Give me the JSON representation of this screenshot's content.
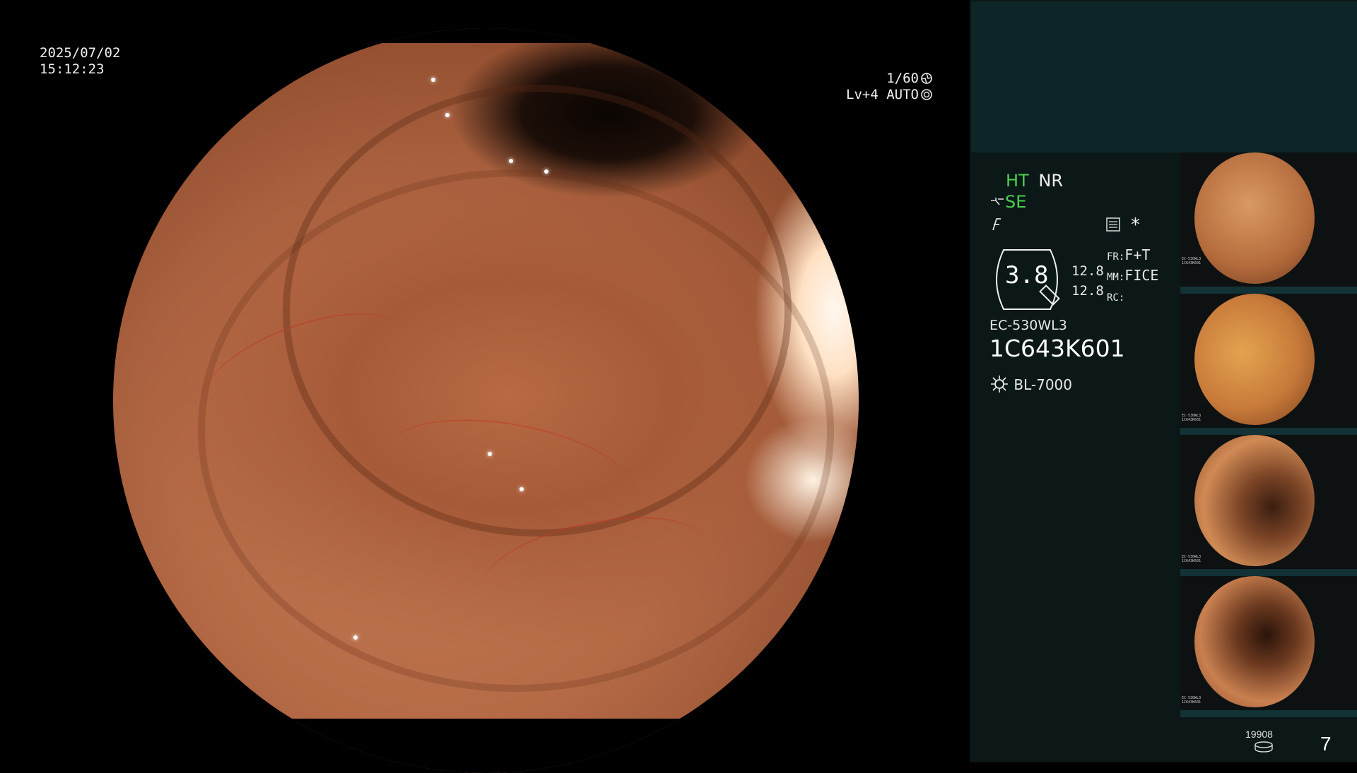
{
  "datetime": {
    "date": "2025/07/02",
    "time": "15:12:23"
  },
  "shutter": {
    "value": "1/60",
    "icon": "shutter-icon"
  },
  "exposure": {
    "level": "Lv+4",
    "mode": "AUTO",
    "icon": "iris-icon"
  },
  "settings": {
    "ht": "HT",
    "nr": "NR",
    "se": "SE",
    "se_icon": "hook-icon",
    "alt_icon": "squiggle-icon",
    "menu_icon": "list-icon",
    "star": "*"
  },
  "zoom": {
    "value": "3.8",
    "icon": "magnifier-icon"
  },
  "measurements": {
    "top": "12.8",
    "bottom": "12.8"
  },
  "modes": [
    {
      "key": "FR:",
      "value": "F+T"
    },
    {
      "key": "MM:",
      "value": "FICE"
    },
    {
      "key": "RC:",
      "value": ""
    }
  ],
  "scope": {
    "model": "EC-530WL3",
    "serial": "1C643K601"
  },
  "light_source": {
    "model": "BL-7000",
    "icon": "lamp-icon"
  },
  "counter": {
    "value": "19908",
    "icon": "disk-icon"
  },
  "image_count": "7",
  "colors": {
    "green": "#49d24c",
    "panel": "#0c1718",
    "header_panel": "#0e2527"
  }
}
